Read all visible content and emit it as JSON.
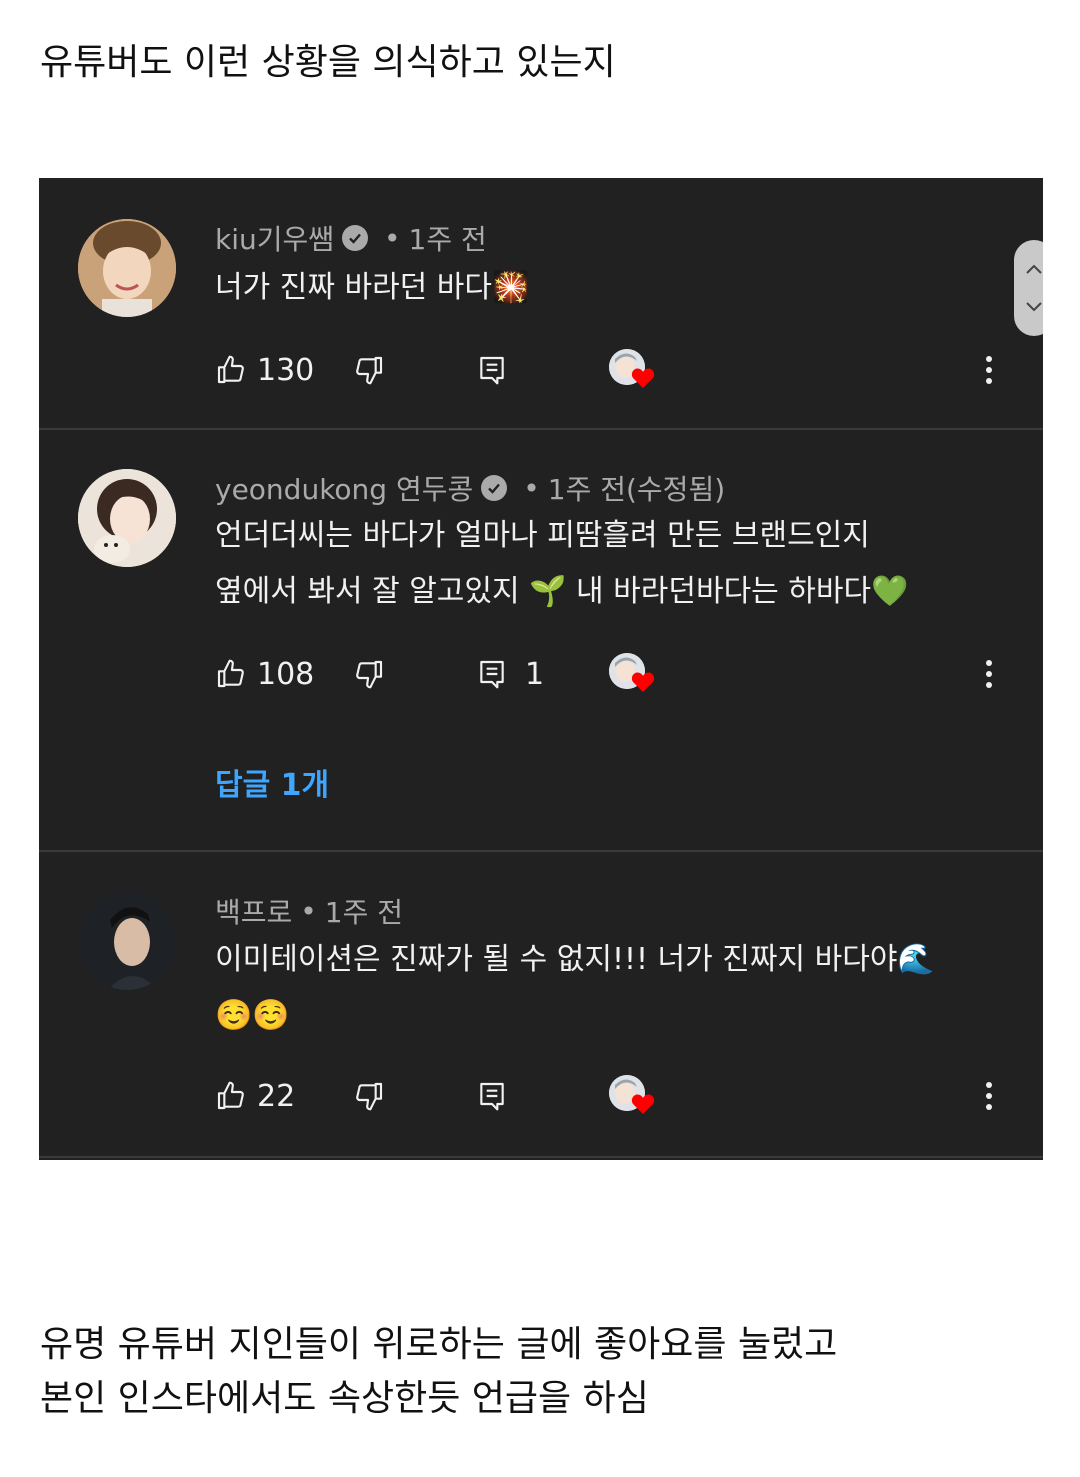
{
  "post": {
    "top_text": "유튜버도 이런 상황을 의식하고 있는지",
    "bottom_line1": "유명 유튜버 지인들이 위로하는 글에 좋아요를 눌렀고",
    "bottom_line2": "본인 인스타에서도 속상한듯 언급을 하심"
  },
  "comments": [
    {
      "author": "kiu기우쌤",
      "verified": true,
      "time": "1주 전",
      "lines": [
        "너가 진짜 바라던 바다🎇"
      ],
      "likes": "130",
      "replies_count": "",
      "creator_hearted": true
    },
    {
      "author": "yeondukong 연두콩",
      "verified": true,
      "time": "1주 전(수정됨)",
      "lines": [
        "언더더씨는 바다가 얼마나 피땀흘려 만든 브랜드인지",
        "옆에서 봐서 잘 알고있지 🌱 내 바라던바다는 하바다💚"
      ],
      "likes": "108",
      "replies_count": "1",
      "creator_hearted": true,
      "replies_link": "답글 1개"
    },
    {
      "author": "백프로",
      "verified": false,
      "time": "1주 전",
      "lines": [
        "이미테이션은 진짜가 될 수 없지!!! 너가 진짜지 바다야🌊",
        "☺️☺️"
      ],
      "likes": "22",
      "replies_count": "",
      "creator_hearted": true
    }
  ],
  "meta": {
    "separator": "•"
  },
  "icons": {
    "like": "thumbs-up-icon",
    "dislike": "thumbs-down-icon",
    "reply": "reply-icon",
    "heart": "creator-heart-icon",
    "more": "more-vert-icon",
    "verified": "verified-check-icon"
  },
  "colors": {
    "panel_bg": "#212121",
    "text": "#f1f1f1",
    "meta": "#aaaaaa",
    "link": "#3ea6ff",
    "heart": "#ff0000"
  }
}
